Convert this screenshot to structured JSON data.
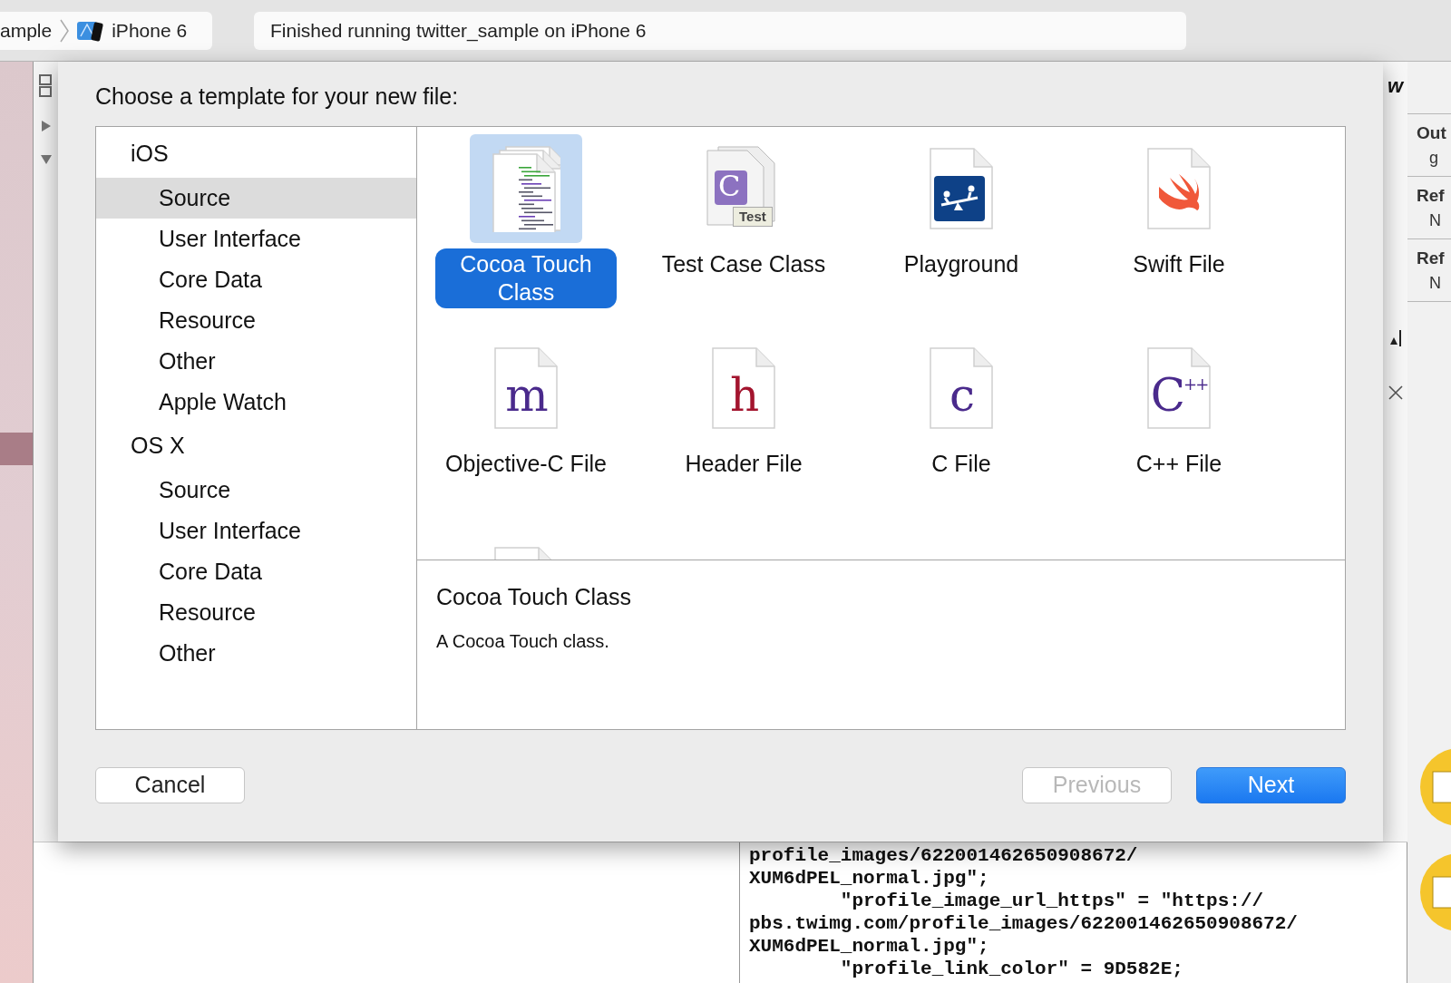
{
  "toolbar": {
    "breadcrumb": [
      {
        "label": "ample",
        "kind": "text"
      },
      {
        "label": "iPhone 6",
        "kind": "device"
      }
    ],
    "status": "Finished running twitter_sample on iPhone 6"
  },
  "sheet": {
    "title": "Choose a template for your new file:",
    "categories": [
      {
        "title": "iOS",
        "items": [
          {
            "label": "Source",
            "selected": true
          },
          {
            "label": "User Interface",
            "selected": false
          },
          {
            "label": "Core Data",
            "selected": false
          },
          {
            "label": "Resource",
            "selected": false
          },
          {
            "label": "Other",
            "selected": false
          },
          {
            "label": "Apple Watch",
            "selected": false
          }
        ]
      },
      {
        "title": "OS X",
        "items": [
          {
            "label": "Source",
            "selected": false
          },
          {
            "label": "User Interface",
            "selected": false
          },
          {
            "label": "Core Data",
            "selected": false
          },
          {
            "label": "Resource",
            "selected": false
          },
          {
            "label": "Other",
            "selected": false
          }
        ]
      }
    ],
    "templates": [
      {
        "label": "Cocoa Touch Class",
        "selected": true,
        "kind": "code"
      },
      {
        "label": "Test Case Class",
        "selected": false,
        "kind": "test",
        "glyph": "C",
        "badge": "Test"
      },
      {
        "label": "Playground",
        "selected": false,
        "kind": "playground"
      },
      {
        "label": "Swift File",
        "selected": false,
        "kind": "swift"
      },
      {
        "label": "Objective-C File",
        "selected": false,
        "kind": "letter",
        "glyph": "m",
        "color": "#4a2a8c"
      },
      {
        "label": "Header File",
        "selected": false,
        "kind": "letter",
        "glyph": "h",
        "color": "#a3142e"
      },
      {
        "label": "C File",
        "selected": false,
        "kind": "letter",
        "glyph": "c",
        "color": "#4a2a8c"
      },
      {
        "label": "C++ File",
        "selected": false,
        "kind": "letter",
        "glyph": "C$^{++}$",
        "color": "#4a2a8c"
      },
      {
        "selected": false,
        "kind": "blank"
      }
    ],
    "description": {
      "title": "Cocoa Touch Class",
      "text": "A Cocoa Touch class."
    },
    "buttons": [
      {
        "label": "Cancel",
        "kind": "normal",
        "disabled": false
      },
      {
        "label": "Previous",
        "kind": "normal",
        "disabled": true
      },
      {
        "label": "Next",
        "kind": "default",
        "disabled": false
      }
    ]
  },
  "editor_edge": {
    "text": "w"
  },
  "inspector": {
    "sections": [
      {
        "title": "Out",
        "value": "g"
      },
      {
        "title": "Ref",
        "value": "N"
      },
      {
        "title": "Ref",
        "value": "N"
      }
    ]
  },
  "console": {
    "lines": [
      "profile_images/622001462650908672/",
      "XUM6dPEL_normal.jpg\";",
      "        \"profile_image_url_https\" = \"https://",
      "pbs.twimg.com/profile_images/622001462650908672/",
      "XUM6dPEL_normal.jpg\";",
      "        \"profile_link_color\" = 9D582E;"
    ]
  }
}
